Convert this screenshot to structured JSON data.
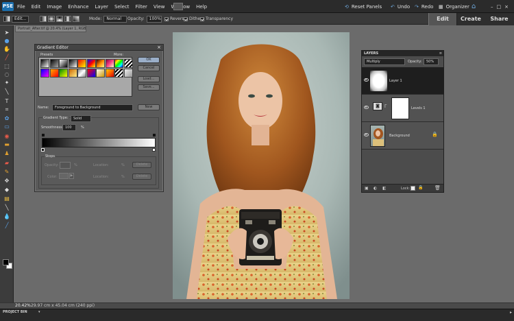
{
  "app": {
    "logo": "PSE"
  },
  "menu": {
    "items": [
      "File",
      "Edit",
      "Image",
      "Enhance",
      "Layer",
      "Select",
      "Filter",
      "View",
      "Window",
      "Help"
    ]
  },
  "topright": {
    "reset_panels": "Reset Panels",
    "undo": "Undo",
    "redo": "Redo",
    "organizer": "Organizer"
  },
  "modes": {
    "edit": "Edit",
    "create": "Create",
    "share": "Share"
  },
  "options_bar": {
    "edit_label": "Edit...",
    "mode_label": "Mode:",
    "mode_value": "Normal",
    "opacity_label": "Opacity:",
    "opacity_value": "100%",
    "reverse": "Reverse",
    "dither": "Dither",
    "transparency": "Transparency"
  },
  "document": {
    "tab_title": "Portrait_After.tif @ 20.4% (Layer 1, RGB/8*) *"
  },
  "gradient_editor": {
    "title": "Gradient Editor",
    "presets_label": "Presets",
    "more_label": "More:",
    "ok": "OK",
    "cancel": "Cancel",
    "load": "Load...",
    "save": "Save...",
    "name_label": "Name:",
    "name_value": "Foreground to Background",
    "new": "New",
    "gradient_type_label": "Gradient Type:",
    "gradient_type_value": "Solid",
    "smoothness_label": "Smoothness:",
    "smoothness_value": "100",
    "percent": "%",
    "stops_label": "Stops",
    "opacity_label": "Opacity:",
    "location_label": "Location:",
    "delete": "Delete",
    "color_label": "Color:"
  },
  "layers_panel": {
    "title": "LAYERS",
    "blend_mode": "Multiply",
    "opacity_label": "Opacity:",
    "opacity_value": "50%",
    "lock_label": "Lock:",
    "layers": [
      {
        "name": "Layer 1"
      },
      {
        "name": "Levels 1"
      },
      {
        "name": "Background"
      }
    ]
  },
  "status": {
    "zoom": "20.42%",
    "doc_info": "29.97 cm x 45.04 cm (240 ppi)"
  },
  "project_bin": {
    "label": "PROJECT BIN"
  },
  "colors": {
    "accent": "#1b6fae",
    "panel_dark": "#2b2b2b",
    "canvas_bg": "#6b6b6b"
  }
}
